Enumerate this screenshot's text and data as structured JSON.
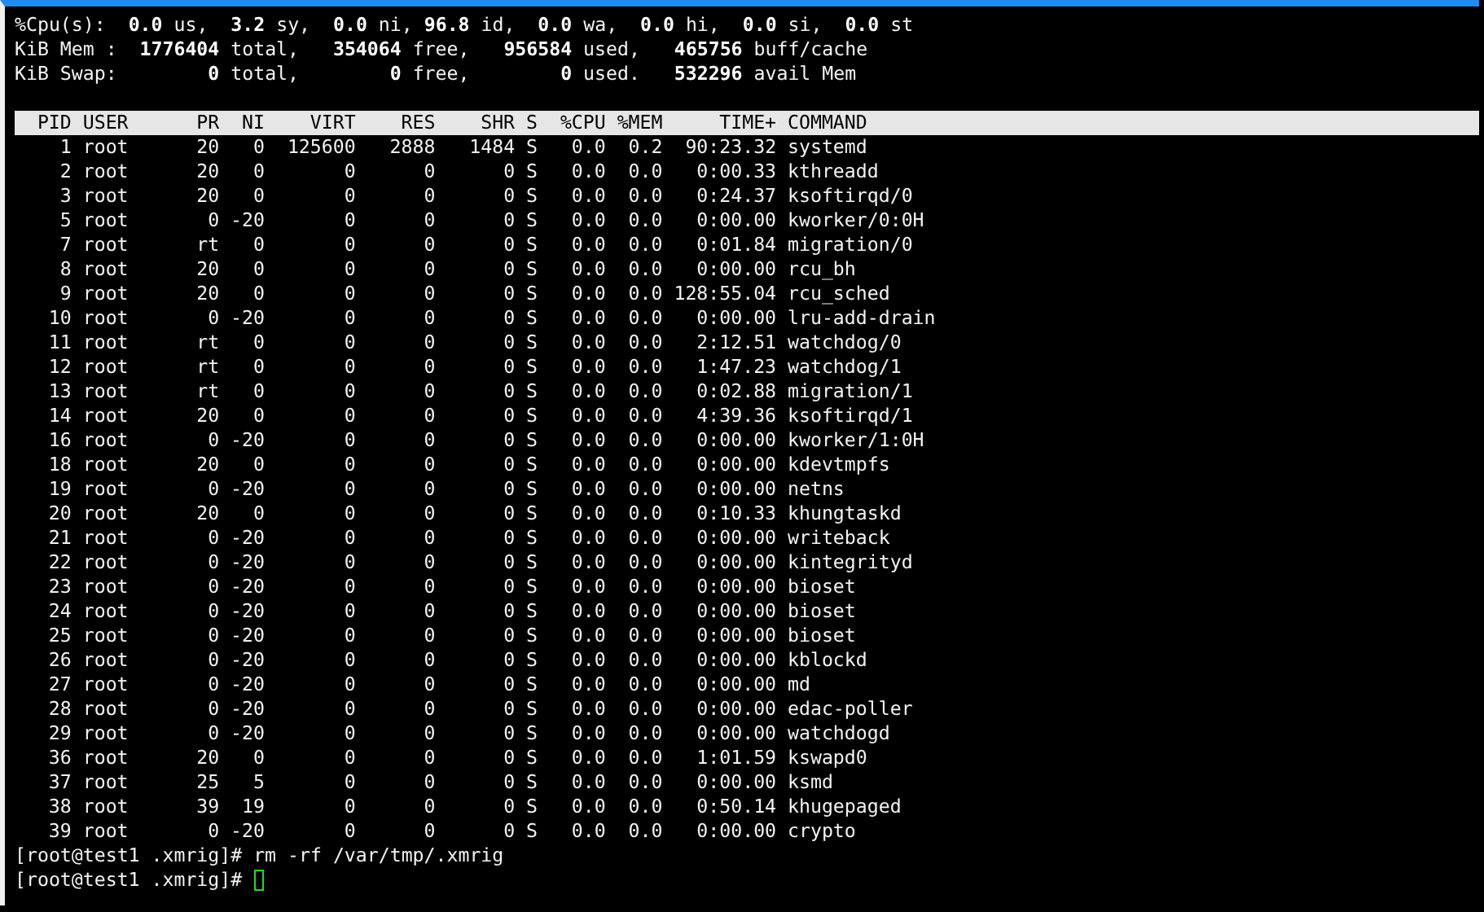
{
  "summary": [
    "%Cpu(s):  **0.0** us,  **3.2** sy,  **0.0** ni, **96.8** id,  **0.0** wa,  **0.0** hi,  **0.0** si,  **0.0** st",
    "KiB Mem :  **1776404** total,   **354064** free,   **956584** used,   **465756** buff/cache",
    "KiB Swap:        **0** total,        **0** free,        **0** used.   **532296** avail Mem"
  ],
  "table": {
    "columns": [
      "PID",
      "USER",
      "PR",
      "NI",
      "VIRT",
      "RES",
      "SHR",
      "S",
      "%CPU",
      "%MEM",
      "TIME+",
      "COMMAND"
    ],
    "rows": [
      [
        "1",
        "root",
        "20",
        "0",
        "125600",
        "2888",
        "1484",
        "S",
        "0.0",
        "0.2",
        "90:23.32",
        "systemd"
      ],
      [
        "2",
        "root",
        "20",
        "0",
        "0",
        "0",
        "0",
        "S",
        "0.0",
        "0.0",
        "0:00.33",
        "kthreadd"
      ],
      [
        "3",
        "root",
        "20",
        "0",
        "0",
        "0",
        "0",
        "S",
        "0.0",
        "0.0",
        "0:24.37",
        "ksoftirqd/0"
      ],
      [
        "5",
        "root",
        "0",
        "-20",
        "0",
        "0",
        "0",
        "S",
        "0.0",
        "0.0",
        "0:00.00",
        "kworker/0:0H"
      ],
      [
        "7",
        "root",
        "rt",
        "0",
        "0",
        "0",
        "0",
        "S",
        "0.0",
        "0.0",
        "0:01.84",
        "migration/0"
      ],
      [
        "8",
        "root",
        "20",
        "0",
        "0",
        "0",
        "0",
        "S",
        "0.0",
        "0.0",
        "0:00.00",
        "rcu_bh"
      ],
      [
        "9",
        "root",
        "20",
        "0",
        "0",
        "0",
        "0",
        "S",
        "0.0",
        "0.0",
        "128:55.04",
        "rcu_sched"
      ],
      [
        "10",
        "root",
        "0",
        "-20",
        "0",
        "0",
        "0",
        "S",
        "0.0",
        "0.0",
        "0:00.00",
        "lru-add-drain"
      ],
      [
        "11",
        "root",
        "rt",
        "0",
        "0",
        "0",
        "0",
        "S",
        "0.0",
        "0.0",
        "2:12.51",
        "watchdog/0"
      ],
      [
        "12",
        "root",
        "rt",
        "0",
        "0",
        "0",
        "0",
        "S",
        "0.0",
        "0.0",
        "1:47.23",
        "watchdog/1"
      ],
      [
        "13",
        "root",
        "rt",
        "0",
        "0",
        "0",
        "0",
        "S",
        "0.0",
        "0.0",
        "0:02.88",
        "migration/1"
      ],
      [
        "14",
        "root",
        "20",
        "0",
        "0",
        "0",
        "0",
        "S",
        "0.0",
        "0.0",
        "4:39.36",
        "ksoftirqd/1"
      ],
      [
        "16",
        "root",
        "0",
        "-20",
        "0",
        "0",
        "0",
        "S",
        "0.0",
        "0.0",
        "0:00.00",
        "kworker/1:0H"
      ],
      [
        "18",
        "root",
        "20",
        "0",
        "0",
        "0",
        "0",
        "S",
        "0.0",
        "0.0",
        "0:00.00",
        "kdevtmpfs"
      ],
      [
        "19",
        "root",
        "0",
        "-20",
        "0",
        "0",
        "0",
        "S",
        "0.0",
        "0.0",
        "0:00.00",
        "netns"
      ],
      [
        "20",
        "root",
        "20",
        "0",
        "0",
        "0",
        "0",
        "S",
        "0.0",
        "0.0",
        "0:10.33",
        "khungtaskd"
      ],
      [
        "21",
        "root",
        "0",
        "-20",
        "0",
        "0",
        "0",
        "S",
        "0.0",
        "0.0",
        "0:00.00",
        "writeback"
      ],
      [
        "22",
        "root",
        "0",
        "-20",
        "0",
        "0",
        "0",
        "S",
        "0.0",
        "0.0",
        "0:00.00",
        "kintegrityd"
      ],
      [
        "23",
        "root",
        "0",
        "-20",
        "0",
        "0",
        "0",
        "S",
        "0.0",
        "0.0",
        "0:00.00",
        "bioset"
      ],
      [
        "24",
        "root",
        "0",
        "-20",
        "0",
        "0",
        "0",
        "S",
        "0.0",
        "0.0",
        "0:00.00",
        "bioset"
      ],
      [
        "25",
        "root",
        "0",
        "-20",
        "0",
        "0",
        "0",
        "S",
        "0.0",
        "0.0",
        "0:00.00",
        "bioset"
      ],
      [
        "26",
        "root",
        "0",
        "-20",
        "0",
        "0",
        "0",
        "S",
        "0.0",
        "0.0",
        "0:00.00",
        "kblockd"
      ],
      [
        "27",
        "root",
        "0",
        "-20",
        "0",
        "0",
        "0",
        "S",
        "0.0",
        "0.0",
        "0:00.00",
        "md"
      ],
      [
        "28",
        "root",
        "0",
        "-20",
        "0",
        "0",
        "0",
        "S",
        "0.0",
        "0.0",
        "0:00.00",
        "edac-poller"
      ],
      [
        "29",
        "root",
        "0",
        "-20",
        "0",
        "0",
        "0",
        "S",
        "0.0",
        "0.0",
        "0:00.00",
        "watchdogd"
      ],
      [
        "36",
        "root",
        "20",
        "0",
        "0",
        "0",
        "0",
        "S",
        "0.0",
        "0.0",
        "1:01.59",
        "kswapd0"
      ],
      [
        "37",
        "root",
        "25",
        "5",
        "0",
        "0",
        "0",
        "S",
        "0.0",
        "0.0",
        "0:00.00",
        "ksmd"
      ],
      [
        "38",
        "root",
        "39",
        "19",
        "0",
        "0",
        "0",
        "S",
        "0.0",
        "0.0",
        "0:50.14",
        "khugepaged"
      ],
      [
        "39",
        "root",
        "0",
        "-20",
        "0",
        "0",
        "0",
        "S",
        "0.0",
        "0.0",
        "0:00.00",
        "crypto"
      ]
    ]
  },
  "prompts": [
    {
      "text": "[root@test1 .xmrig]# rm -rf /var/tmp/.xmrig",
      "cursor": false
    },
    {
      "text": "[root@test1 .xmrig]#",
      "cursor": true
    }
  ]
}
